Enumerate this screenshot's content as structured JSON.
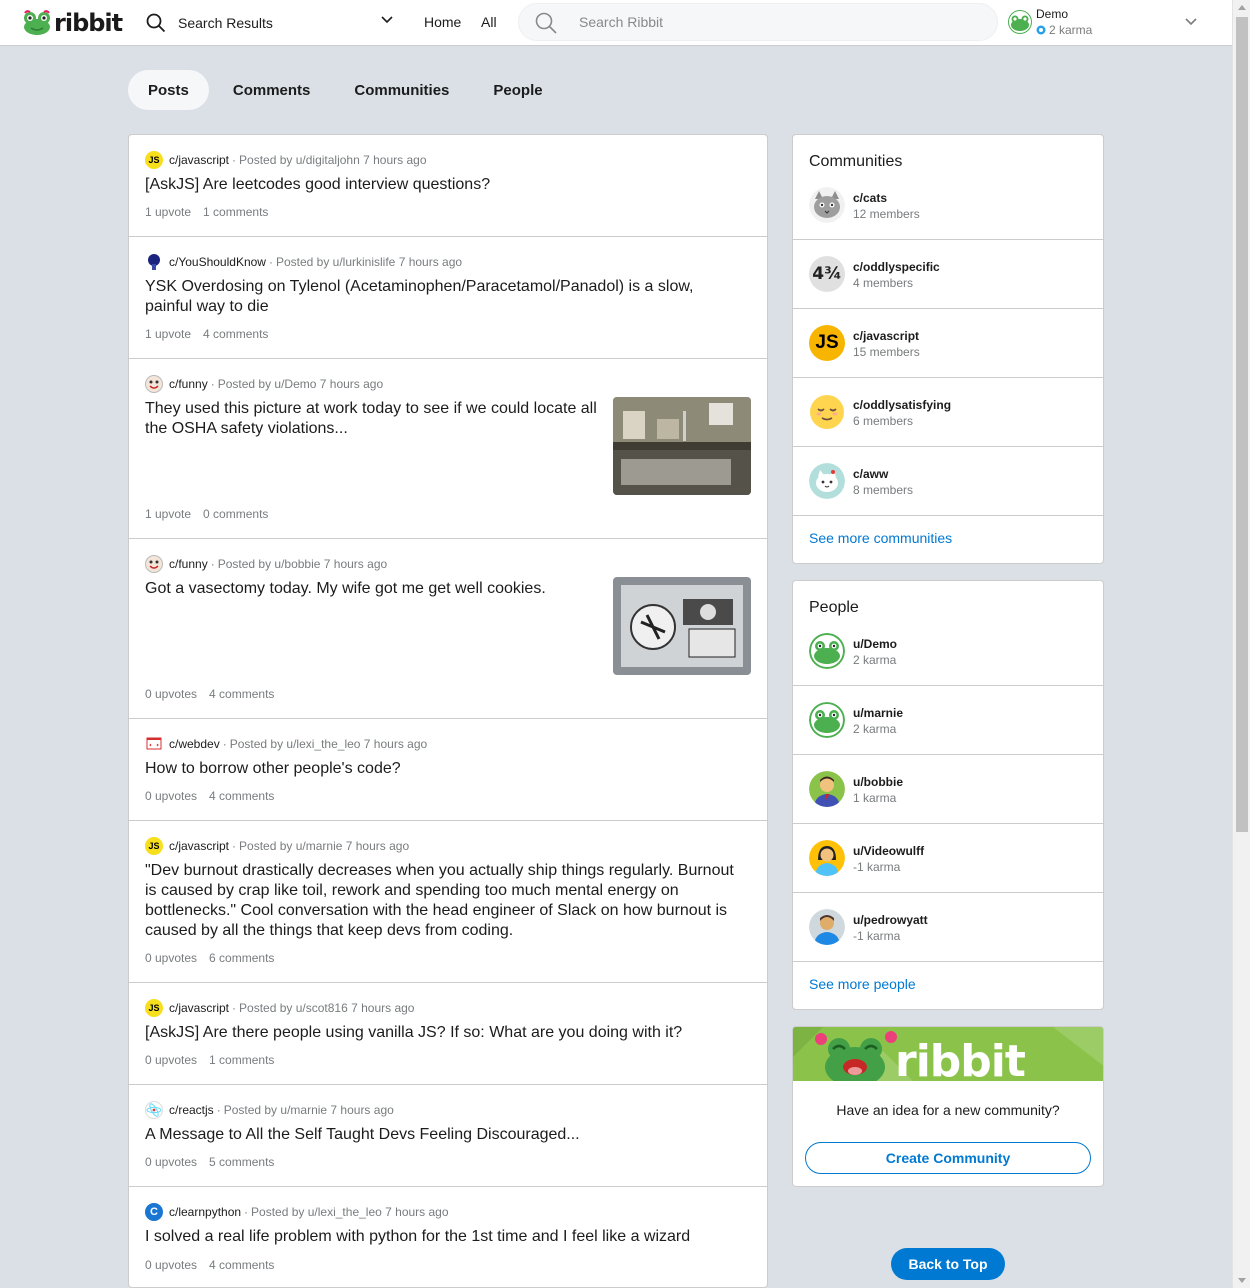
{
  "brand": {
    "name": "ribbit"
  },
  "header": {
    "location_label": "Search Results",
    "nav": [
      "Home",
      "All"
    ],
    "search_placeholder": "Search Ribbit",
    "user_name": "Demo",
    "user_karma": "2 karma"
  },
  "tabs": [
    "Posts",
    "Comments",
    "Communities",
    "People"
  ],
  "active_tab": "Posts",
  "posts": [
    {
      "community": "c/javascript",
      "byline": "Posted by u/digitaljohn 7 hours ago",
      "title": "[AskJS] Are leetcodes good interview questions?",
      "votes": "1 upvote",
      "comments": "1 comments",
      "icon": "js-icon"
    },
    {
      "community": "c/YouShouldKnow",
      "byline": "Posted by u/lurkinislife 7 hours ago",
      "title": "YSK Overdosing on Tylenol (Acetaminophen/Paracetamol/Panadol) is a slow, painful way to die",
      "votes": "1 upvote",
      "comments": "4 comments",
      "icon": "brain-icon"
    },
    {
      "community": "c/funny",
      "byline": "Posted by u/Demo 7 hours ago",
      "title": "They used this picture at work today to see if we could locate all the OSHA safety violations...",
      "votes": "1 upvote",
      "comments": "0 comments",
      "icon": "funny-icon",
      "thumb": "sink-photo"
    },
    {
      "community": "c/funny",
      "byline": "Posted by u/bobbie 7 hours ago",
      "title": "Got a vasectomy today. My wife got me get well cookies.",
      "votes": "0 upvotes",
      "comments": "4 comments",
      "icon": "funny-icon",
      "thumb": "cookies-photo"
    },
    {
      "community": "c/webdev",
      "byline": "Posted by u/lexi_the_leo 7 hours ago",
      "title": "How to borrow other people's code?",
      "votes": "0 upvotes",
      "comments": "4 comments",
      "icon": "webdev-icon"
    },
    {
      "community": "c/javascript",
      "byline": "Posted by u/marnie 7 hours ago",
      "title": "\"Dev burnout drastically decreases when you actually ship things regularly. Burnout is caused by crap like toil, rework and spending too much mental energy on bottlenecks.\" Cool conversation with the head engineer of Slack on how burnout is caused by all the things that keep devs from coding.",
      "votes": "0 upvotes",
      "comments": "6 comments",
      "icon": "js-icon"
    },
    {
      "community": "c/javascript",
      "byline": "Posted by u/scot816 7 hours ago",
      "title": "[AskJS] Are there people using vanilla JS? If so: What are you doing with it?",
      "votes": "0 upvotes",
      "comments": "1 comments",
      "icon": "js-icon"
    },
    {
      "community": "c/reactjs",
      "byline": "Posted by u/marnie 7 hours ago",
      "title": "A Message to All the Self Taught Devs Feeling Discouraged...",
      "votes": "0 upvotes",
      "comments": "5 comments",
      "icon": "react-icon"
    },
    {
      "community": "c/learnpython",
      "byline": "Posted by u/lexi_the_leo 7 hours ago",
      "title": "I solved a real life problem with python for the 1st time and I feel like a wizard",
      "votes": "0 upvotes",
      "comments": "4 comments",
      "icon": "python-icon"
    }
  ],
  "communities": {
    "title": "Communities",
    "items": [
      {
        "name": "c/cats",
        "members": "12 members"
      },
      {
        "name": "c/oddlyspecific",
        "members": "4 members"
      },
      {
        "name": "c/javascript",
        "members": "15 members"
      },
      {
        "name": "c/oddlysatisfying",
        "members": "6 members"
      },
      {
        "name": "c/aww",
        "members": "8 members"
      }
    ],
    "more": "See more communities",
    "oddly_icon_text": "4¾"
  },
  "people": {
    "title": "People",
    "items": [
      {
        "name": "u/Demo",
        "karma": "2 karma"
      },
      {
        "name": "u/marnie",
        "karma": "2 karma"
      },
      {
        "name": "u/bobbie",
        "karma": "1 karma"
      },
      {
        "name": "u/Videowulff",
        "karma": "-1 karma"
      },
      {
        "name": "u/pedrowyatt",
        "karma": "-1 karma"
      }
    ],
    "more": "See more people"
  },
  "promo": {
    "text": "Have an idea for a new community?",
    "button": "Create Community"
  },
  "back_to_top": "Back to Top",
  "colors": {
    "accent": "#0079d3",
    "background": "#dae0e6",
    "js_yellow": "#f7df1e"
  }
}
